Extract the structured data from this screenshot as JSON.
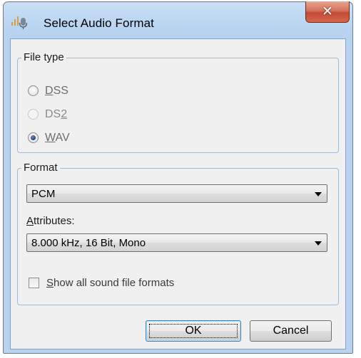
{
  "window": {
    "title": "Select Audio Format"
  },
  "file_type": {
    "legend": "File type",
    "options": [
      {
        "pre": "",
        "key": "D",
        "post": "SS",
        "state": "unselected-enabled"
      },
      {
        "pre": "DS",
        "key": "2",
        "post": "",
        "state": "unselected-disabled"
      },
      {
        "pre": "",
        "key": "W",
        "post": "AV",
        "state": "selected"
      }
    ]
  },
  "format": {
    "legend": "Format",
    "codec": {
      "value": "PCM"
    },
    "attributes": {
      "label_key": "A",
      "label_rest": "ttributes:",
      "value": "8.000 kHz, 16 Bit, Mono"
    },
    "show_all": {
      "label_key": "S",
      "label_rest": "how all sound file formats",
      "checked": false
    }
  },
  "buttons": {
    "ok": "OK",
    "cancel": "Cancel"
  },
  "icons": {
    "title": "audio-mic-icon",
    "close": "close-icon"
  },
  "colors": {
    "close": "#c24b33",
    "selected_dot": "#1f3f6e",
    "group_border": "#a5b9cf"
  }
}
